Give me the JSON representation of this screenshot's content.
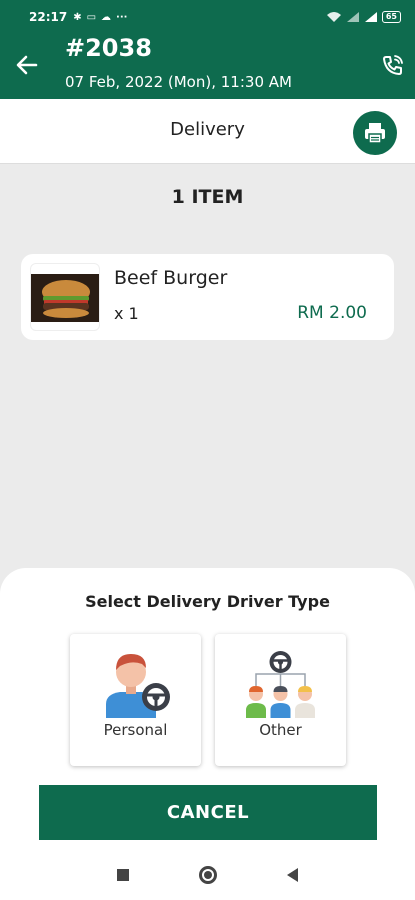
{
  "status_bar": {
    "time": "22:17",
    "battery": "65"
  },
  "header": {
    "order_number": "#2038",
    "order_datetime": "07 Feb, 2022 (Mon), 11:30 AM",
    "back_icon": "arrow-left-icon",
    "call_icon": "phone-call-icon"
  },
  "subheader": {
    "title": "Delivery",
    "print_icon": "printer-icon"
  },
  "order": {
    "item_count_label": "1 ITEM",
    "items": [
      {
        "name": "Beef Burger",
        "qty": "x 1",
        "price": "RM 2.00"
      }
    ]
  },
  "sheet": {
    "title": "Select Delivery Driver Type",
    "options": [
      {
        "label": "Personal",
        "icon": "personal-driver-icon"
      },
      {
        "label": "Other",
        "icon": "other-driver-icon"
      }
    ],
    "cancel_label": "CANCEL"
  },
  "colors": {
    "primary": "#0e6b4e",
    "background": "#ebebeb"
  }
}
